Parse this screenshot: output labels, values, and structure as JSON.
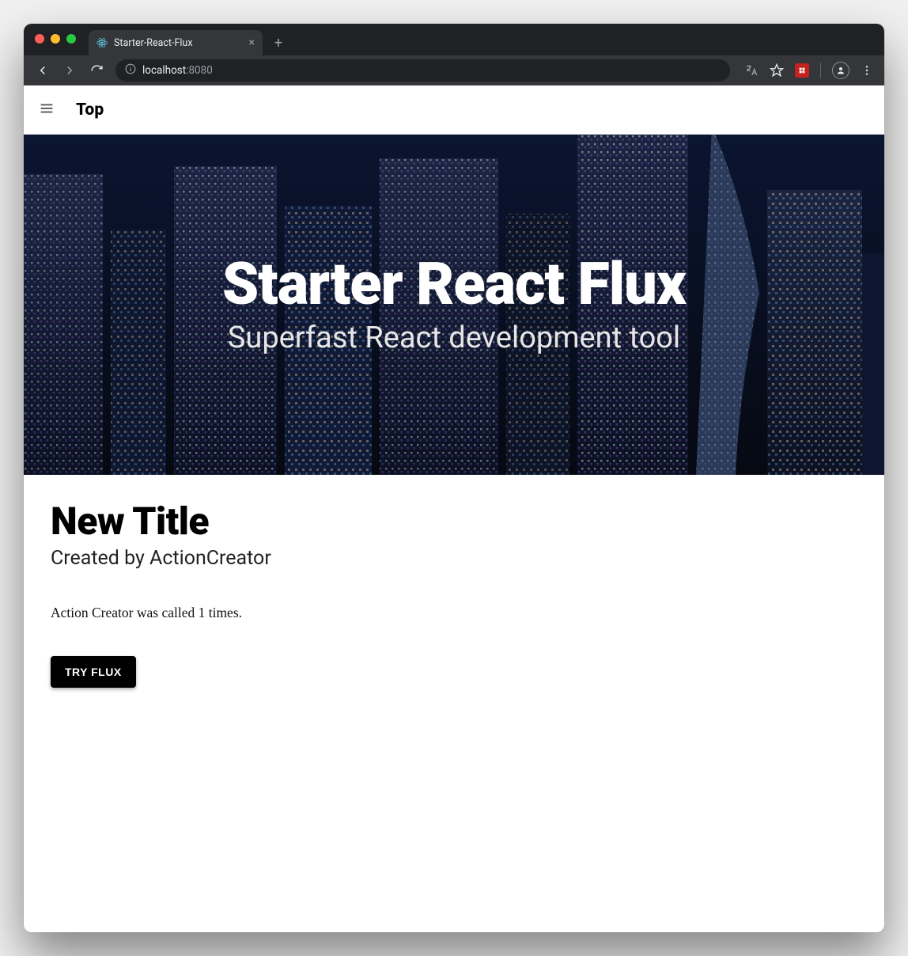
{
  "browser": {
    "tab_title": "Starter-React-Flux",
    "url_host": "localhost",
    "url_port": ":8080"
  },
  "appbar": {
    "title": "Top"
  },
  "hero": {
    "title": "Starter React Flux",
    "subtitle": "Superfast React development tool"
  },
  "content": {
    "title": "New Title",
    "subtitle": "Created by ActionCreator",
    "status": "Action Creator was called 1 times.",
    "button_label": "TRY FLUX"
  },
  "colors": {
    "react_blue": "#61dafb",
    "chrome_dark": "#202124",
    "chrome_panel": "#35363a",
    "ext_red": "#c5221f"
  }
}
